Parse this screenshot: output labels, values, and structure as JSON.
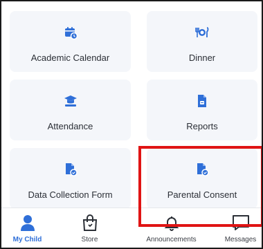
{
  "colors": {
    "accent": "#2f6fd8",
    "tile_bg": "#f4f6fa",
    "highlight": "#e01414"
  },
  "tiles": [
    {
      "label": "Academic Calendar",
      "icon": "calendar-icon"
    },
    {
      "label": "Dinner",
      "icon": "dinner-icon"
    },
    {
      "label": "Attendance",
      "icon": "graduation-cap-icon"
    },
    {
      "label": "Reports",
      "icon": "report-document-icon"
    },
    {
      "label": "Data Collection Form",
      "icon": "form-document-icon"
    },
    {
      "label": "Parental Consent",
      "icon": "consent-document-icon"
    }
  ],
  "tabbar": [
    {
      "label": "My Child",
      "icon": "person-icon",
      "active": true
    },
    {
      "label": "Store",
      "icon": "shopping-bag-icon",
      "active": false
    },
    {
      "label": "Announcements",
      "icon": "bell-icon",
      "active": false
    },
    {
      "label": "Messages",
      "icon": "message-icon",
      "active": false
    }
  ]
}
